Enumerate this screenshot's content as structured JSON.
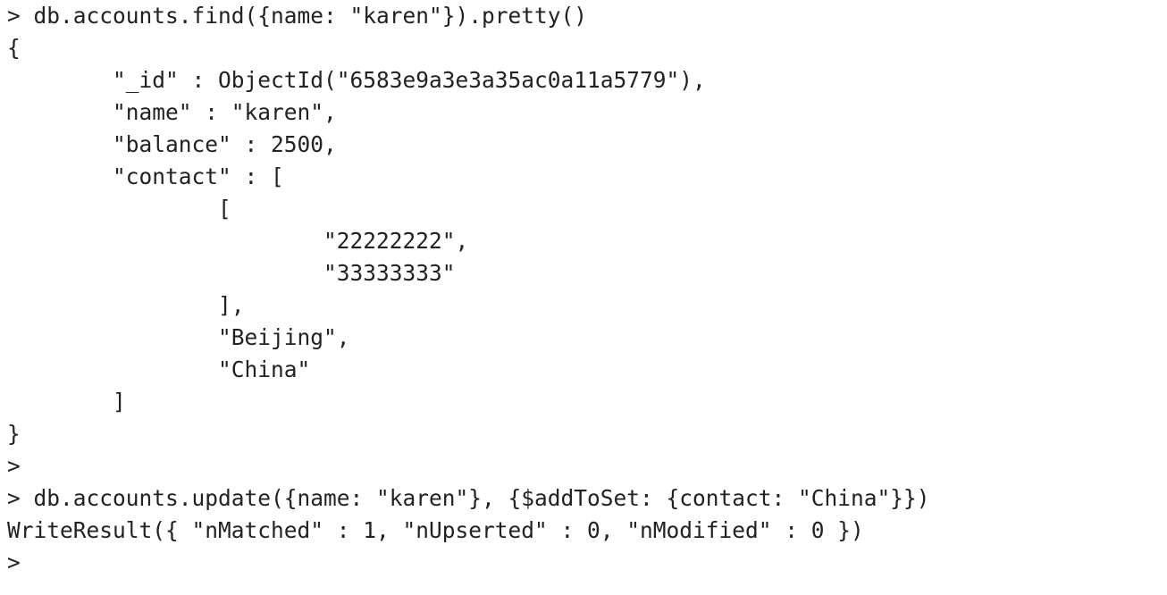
{
  "terminal": {
    "lines": [
      "> db.accounts.find({name: \"karen\"}).pretty()",
      "{",
      "        \"_id\" : ObjectId(\"6583e9a3e3a35ac0a11a5779\"),",
      "        \"name\" : \"karen\",",
      "        \"balance\" : 2500,",
      "        \"contact\" : [",
      "                [",
      "                        \"22222222\",",
      "                        \"33333333\"",
      "                ],",
      "                \"Beijing\",",
      "                \"China\"",
      "        ]",
      "}",
      ">",
      "> db.accounts.update({name: \"karen\"}, {$addToSet: {contact: \"China\"}})",
      "WriteResult({ \"nMatched\" : 1, \"nUpserted\" : 0, \"nModified\" : 0 })",
      ">"
    ]
  }
}
